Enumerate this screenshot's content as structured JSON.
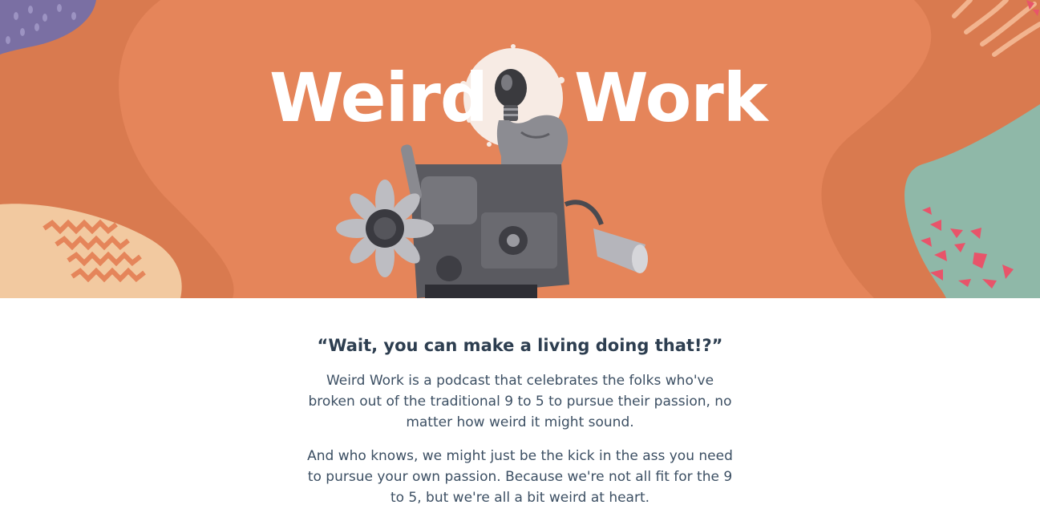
{
  "hero": {
    "title_word_1": "Weird",
    "title_word_2": "Work",
    "colors": {
      "background": "#e5855a",
      "blob_dark_orange": "#d97a4f",
      "blob_purple": "#7a6fa3",
      "blob_peach": "#f2c9a0",
      "blob_teal": "#8fb8a8",
      "accent_pink": "#e8546a"
    },
    "illustration": "lightbulb-machine-collage"
  },
  "content": {
    "tagline": "“Wait, you can make a living doing that!?”",
    "paragraph_1": "Weird Work is a podcast that celebrates the folks who've broken out of the traditional 9 to 5 to pursue their passion, no matter how weird it might sound.",
    "paragraph_2": "And who knows, we might just be the kick in the ass you need to pursue your own passion. Because we're not all fit for the 9 to 5, but we're all a bit weird at heart."
  }
}
